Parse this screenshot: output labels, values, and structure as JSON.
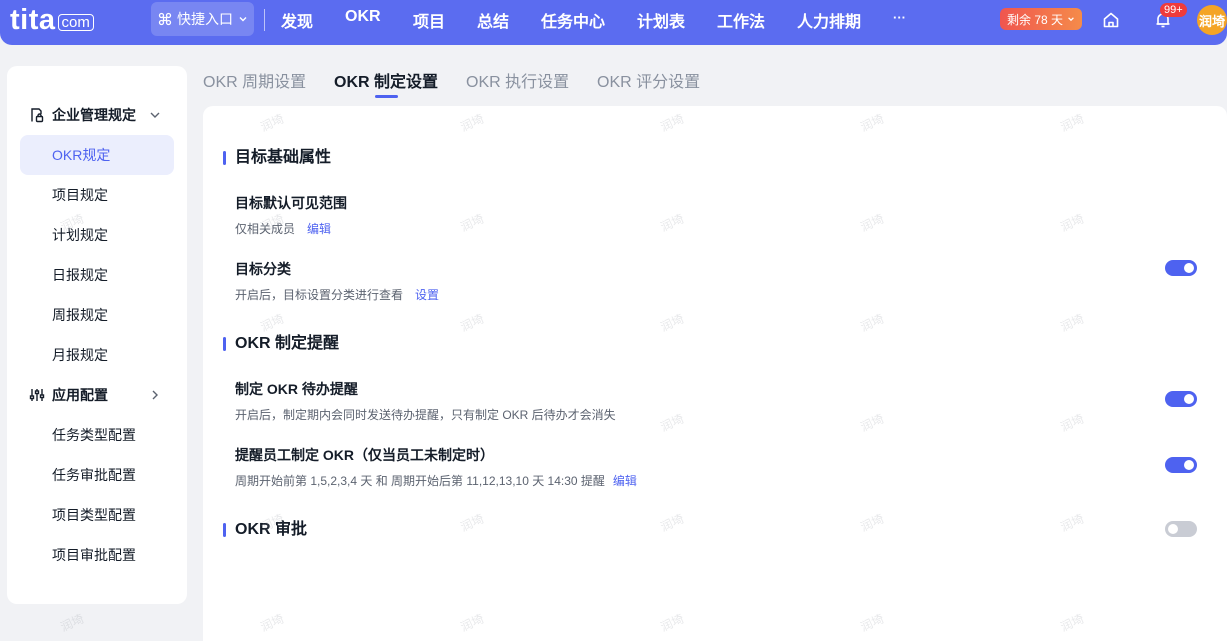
{
  "topbar": {
    "logo_text": "tita",
    "logo_suffix": "com",
    "quick_entry": "快捷入口",
    "nav": [
      "发现",
      "OKR",
      "项目",
      "总结",
      "任务中心",
      "计划表",
      "工作法",
      "人力排期",
      "···"
    ],
    "trial_text": "剩余 78 天",
    "notification_count": "99+",
    "avatar_text": "润埼"
  },
  "sidebar": {
    "group1": {
      "label": "企业管理规定"
    },
    "group1_items": [
      "OKR规定",
      "项目规定",
      "计划规定",
      "日报规定",
      "周报规定",
      "月报规定"
    ],
    "group2": {
      "label": "应用配置"
    },
    "group2_items": [
      "任务类型配置",
      "任务审批配置",
      "项目类型配置",
      "项目审批配置"
    ]
  },
  "tabs": [
    "OKR 周期设置",
    "OKR 制定设置",
    "OKR 执行设置",
    "OKR 评分设置"
  ],
  "main": {
    "section1_title": "目标基础属性",
    "visibility_title": "目标默认可见范围",
    "visibility_desc": "仅相关成员",
    "visibility_link": "编辑",
    "category_title": "目标分类",
    "category_desc": "开启后，目标设置分类进行查看",
    "category_link": "设置",
    "section2_title": "OKR 制定提醒",
    "todo_title": "制定 OKR 待办提醒",
    "todo_desc": "开启后，制定期内会同时发送待办提醒，只有制定 OKR 后待办才会消失",
    "remind_title": "提醒员工制定 OKR（仅当员工未制定时）",
    "remind_desc": "周期开始前第 1,5,2,3,4 天 和 周期开始后第 11,12,13,10 天 14:30 提醒",
    "remind_link": "编辑",
    "section3_title": "OKR 审批"
  },
  "toggles": {
    "category": true,
    "todo": true,
    "remind": true,
    "approval": false
  },
  "colors": {
    "brand": "#5b6cf0",
    "accent": "#4e62f0",
    "toggle_off": "#c9ccd4"
  },
  "watermark": "润埼"
}
